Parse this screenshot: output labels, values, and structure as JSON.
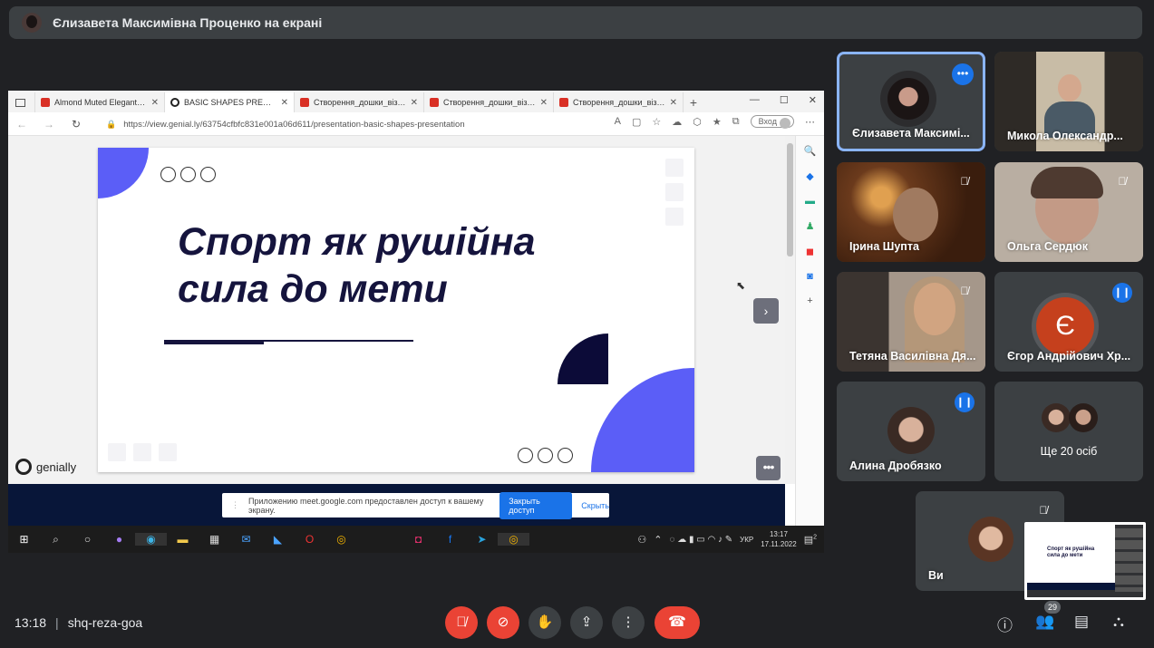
{
  "presenter_banner": {
    "text": "Єлизавета Максимівна Проценко на екрані"
  },
  "browser": {
    "tabs": [
      {
        "label": "Almond Muted Elegant Lir",
        "icon": "pdf-icon",
        "active": false
      },
      {
        "label": "BASIC SHAPES PRESENTAT",
        "icon": "genially-icon",
        "active": true
      },
      {
        "label": "Створення_дошки_візуал",
        "icon": "pdf-icon",
        "active": false
      },
      {
        "label": "Створення_дошки_візуал",
        "icon": "pdf-icon",
        "active": false
      },
      {
        "label": "Створення_дошки_візуал",
        "icon": "pdf-icon",
        "active": false
      }
    ],
    "new_tab": "+",
    "url": "https://view.genial.ly/63754cfbfc831e001a06d611/presentation-basic-shapes-presentation",
    "login_label": "Вход"
  },
  "slide": {
    "title_line1": "Спорт як рушійна",
    "title_line2": "сила до мети",
    "brand": "genially",
    "accent_color": "#5b5ef7",
    "dark_color": "#0c0b38"
  },
  "share_notice": {
    "message": "Приложению meet.google.com предоставлен доступ к вашему экрану.",
    "stop_label": "Закрыть доступ",
    "hide_label": "Скрыть"
  },
  "taskbar": {
    "language": "УКР",
    "time": "13:17",
    "date": "17.11.2022",
    "notification_count": "2"
  },
  "participants": [
    {
      "name": "Єлизавета Максимі...",
      "state": "more",
      "highlighted": true
    },
    {
      "name": "Микола Олександр...",
      "state": "none"
    },
    {
      "name": "Ірина Шупта",
      "state": "muted"
    },
    {
      "name": "Ольга Сердюк",
      "state": "muted"
    },
    {
      "name": "Тетяна Василівна Дя...",
      "state": "muted"
    },
    {
      "name": "Єгор Андрійович Хр...",
      "state": "speaking",
      "avatar_letter": "Є",
      "avatar_color": "#c5401d"
    },
    {
      "name": "Алина Дробязко",
      "state": "speaking"
    },
    {
      "name": "Ще 20 осіб",
      "state": "none"
    },
    {
      "name": "Ви",
      "state": "muted"
    }
  ],
  "meeting": {
    "time": "13:18",
    "code": "shq-reza-goa",
    "participant_count": "29"
  },
  "colors": {
    "background": "#202124",
    "tile": "#3c4043",
    "danger": "#ea4335",
    "accent": "#1a73e8"
  }
}
